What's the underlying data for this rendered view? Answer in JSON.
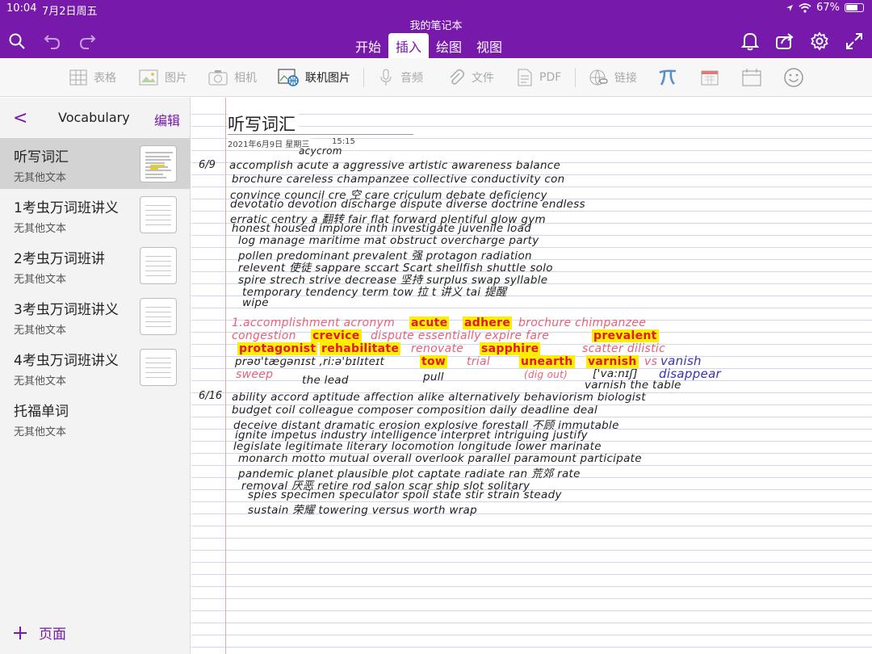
{
  "status": {
    "time": "10:04",
    "date": "7月2日周五",
    "battery": "67%"
  },
  "notebook_title": "我的笔记本",
  "tabs": [
    "开始",
    "插入",
    "绘图",
    "视图"
  ],
  "ribbon": {
    "table": "表格",
    "picture": "图片",
    "camera": "相机",
    "online_picture": "联机图片",
    "audio": "音频",
    "file": "文件",
    "pdf": "PDF",
    "link": "链接"
  },
  "sidebar": {
    "back": "<",
    "title": "Vocabulary",
    "edit": "编辑",
    "items": [
      {
        "title": "听写词汇",
        "sub": "无其他文本"
      },
      {
        "title": "1考虫万词班讲义",
        "sub": "无其他文本"
      },
      {
        "title": "2考虫万词班讲",
        "sub": "无其他文本"
      },
      {
        "title": "3考虫万词班讲义",
        "sub": "无其他文本"
      },
      {
        "title": "4考虫万词班讲义",
        "sub": "无其他文本"
      },
      {
        "title": "托福单词",
        "sub": "无其他文本"
      }
    ],
    "add_page": "页面"
  },
  "page": {
    "title": "听写词汇",
    "date": "2021年6月9日 星期三",
    "time": "15:15",
    "date_marks": [
      "6/9",
      "6/16"
    ],
    "handwriting": {
      "block1": [
        "acycrom",
        "accomplish acute  a  aggressive  artistic  awareness  balance",
        "brochure  careless  champanzee  collective  conductivity  con",
        "convince  council  cre 空  care  criculum  debate  deficiency",
        "devotatio devotion  discharge  dispute  diverse  doctrine  endless",
        "erratic  centry  a  翻转  fair  flat  forward  plentiful glow  gym",
        "honest  housed  implore  inth  investigate  juvenile  load",
        "log  manage  maritime  mat  obstruct  overcharge  party",
        "pollen  predominant  prevalent  强  protagon  radiation",
        "relevent  使徒 sappare  sccart  Scart  shellfish  shuttle  solo",
        "spire  strech  strive  decrease 坚持  surplus  swap  syllable",
        "temporary  tendency  term  tow  拉 t  讲义  tai  提醒",
        "wipe"
      ],
      "block2_red": "1.accomplishment  acronym",
      "block2_hl": [
        "acute",
        "adhere",
        "crevice",
        "prevalent",
        "protagonist",
        "rehabilitate",
        "sapphire",
        "tow",
        "unearth",
        "varnish"
      ],
      "block2_pink": [
        "brochure  chimpanzee",
        "congestion",
        "dispute  essentially  expire  fare",
        "renovate",
        "scatter  dilistic",
        "sweep",
        "trial",
        "(dig out)",
        "vs"
      ],
      "block2_black": [
        "prəʊ'tæɡənɪst  ,ri:ə'bɪlɪteɪt",
        "the lead",
        "pull",
        "['va:nɪʃ]",
        "varnish the table"
      ],
      "block2_purple": [
        "vanish",
        "disappear"
      ],
      "block3": [
        "ability  accord  aptitude  affection  alike  alternatively  behaviorism  biologist",
        "budget  coil  colleague  composer  composition  daily  deadline  deal",
        "deceive  distant  dramatic  erosion  explosive  forestall  不顾 immutable",
        "ignite  impetus  industry  intelligence  interpret  intriguing  justify",
        "legislate  legitimate  literary  locomotion  longitude  lower  marinate",
        "monarch  motto  mutual  overall  overlook  parallel  paramount  participate",
        "pandemic  planet  plausible  plot  captate  radiate  ran 荒郊  rate",
        "removal  厌恶  retire  rod  salon  scar  ship  slot  solitary",
        "spies  specimen  speculator  spoil  state  stir  strain  steady",
        "sustain  荣耀  towering  versus  worth  wrap"
      ]
    }
  },
  "colors": {
    "accent": "#7719aa",
    "highlight": "#ffee00",
    "ink_red": "#e01a2c",
    "ink_pink": "#e8607a",
    "ink_purple": "#3d2fb4"
  }
}
